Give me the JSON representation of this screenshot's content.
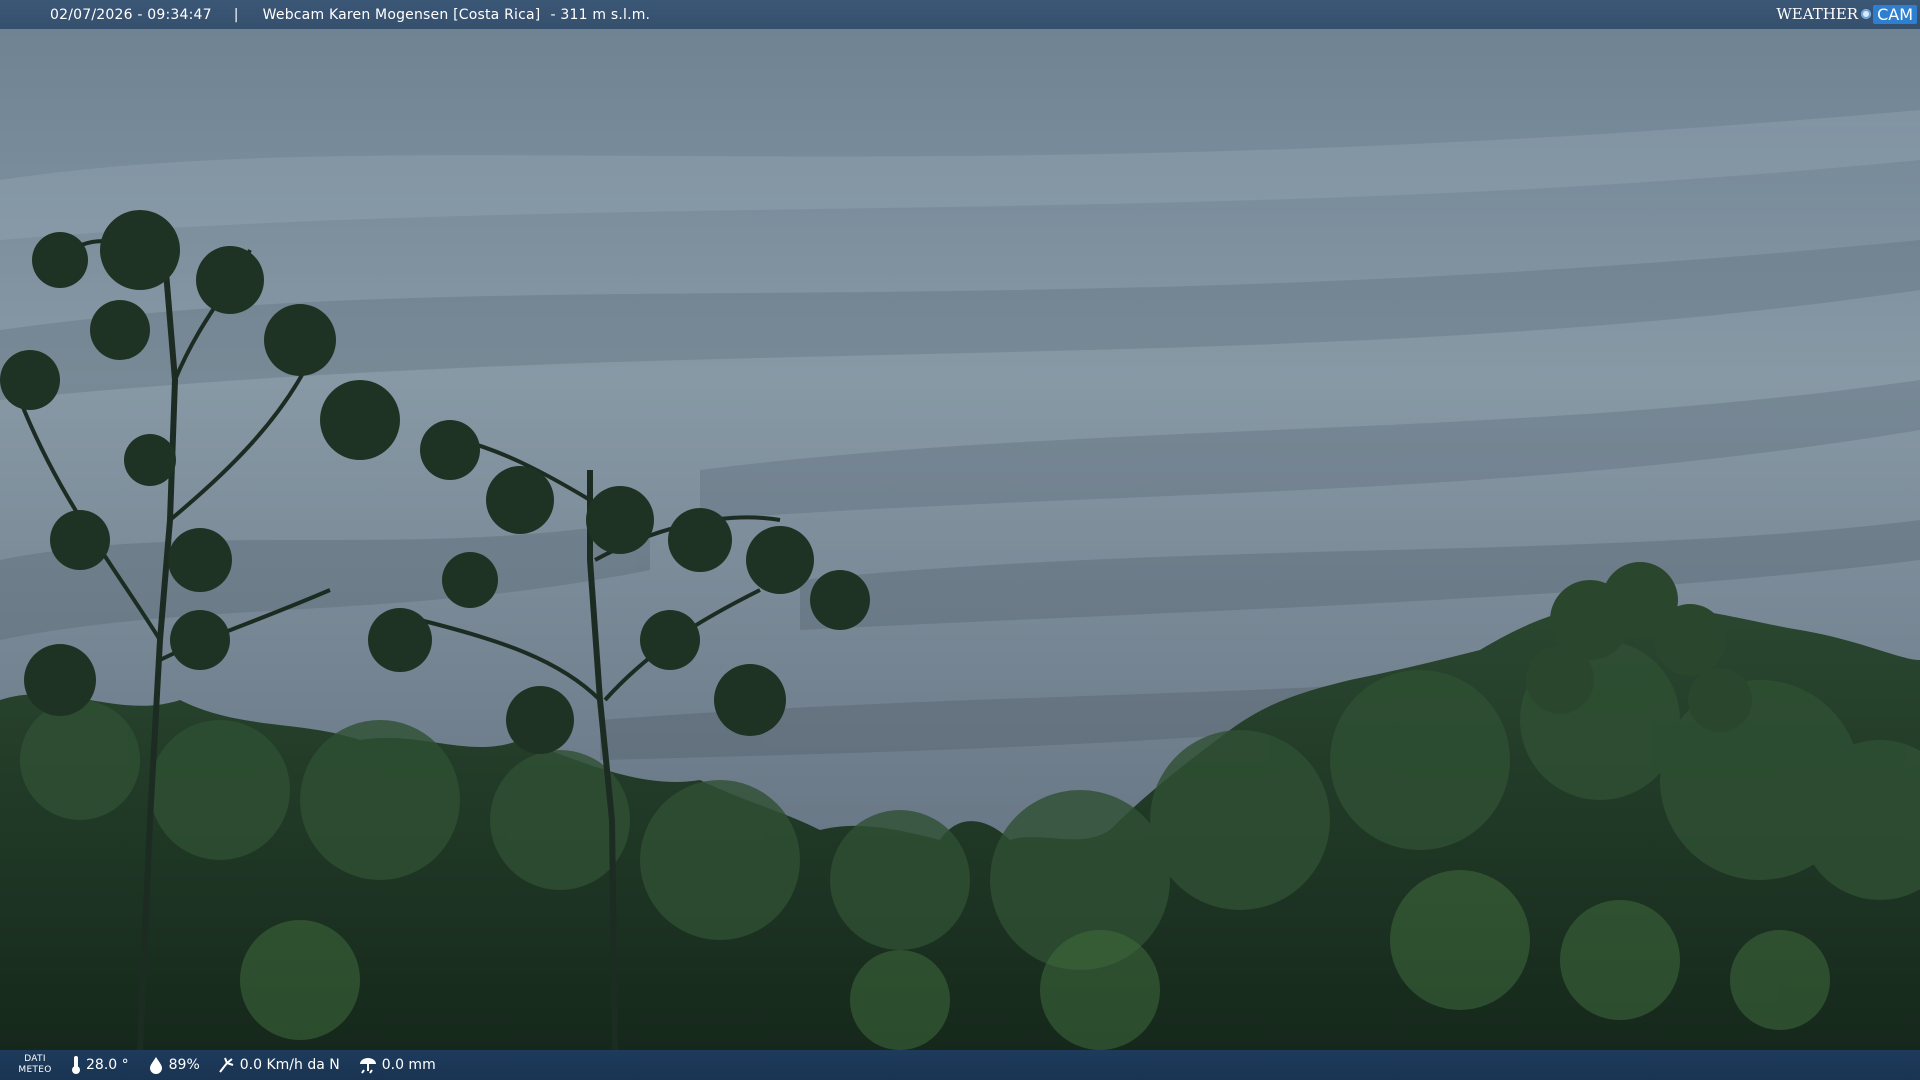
{
  "header": {
    "timestamp": "02/07/2026 - 09:34:47",
    "separator": "|",
    "title": "Webcam Karen Mogensen [Costa Rica]",
    "altitude": "- 311 m s.l.m."
  },
  "logo": {
    "left": "WEATHER",
    "right": "CAM"
  },
  "footer": {
    "label_line1": "DATI",
    "label_line2": "METEO",
    "temperature": "28.0 °",
    "humidity": "89%",
    "wind": "0.0 Km/h da N",
    "rain": "0.0 mm"
  },
  "colors": {
    "bar_top": "#3b5776",
    "bar_bottom": "#1e3b5c",
    "sky": "#7c8d9b",
    "foliage": "#1f3a22"
  },
  "icons": [
    "thermometer-icon",
    "humidity-drop-icon",
    "wind-icon",
    "rain-gauge-icon"
  ]
}
